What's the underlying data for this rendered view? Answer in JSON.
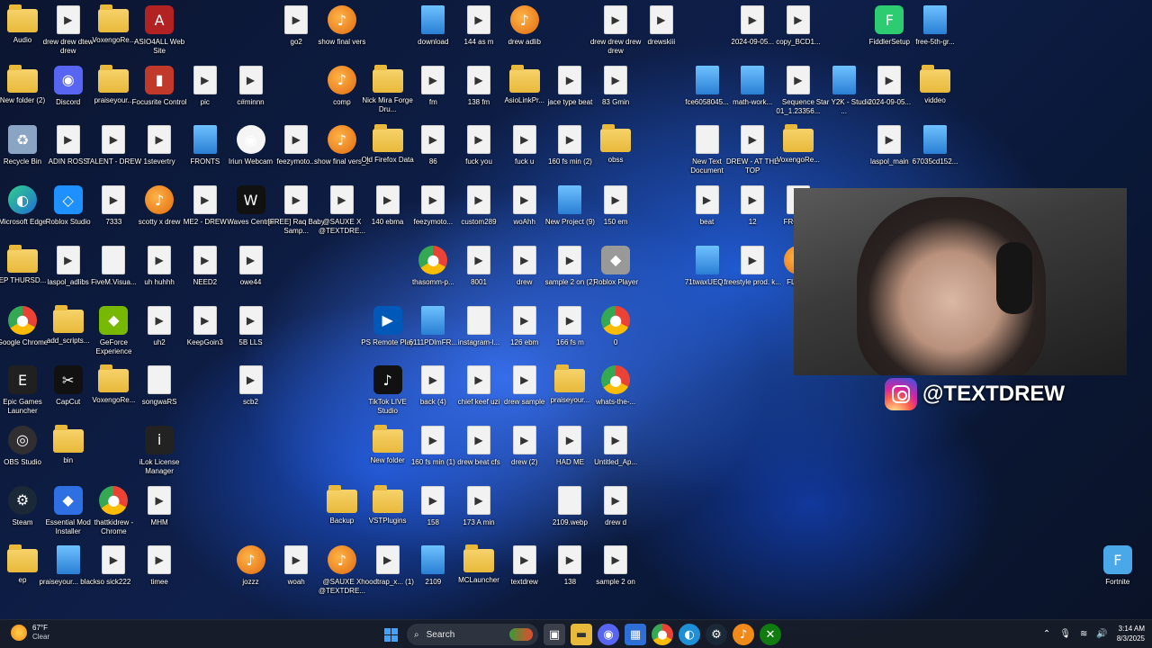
{
  "desktop": {
    "icons": [
      {
        "label": "Audio",
        "icon": "folder-icon"
      },
      {
        "label": "drew drew dtew drew",
        "icon": "file-icon"
      },
      {
        "label": "VoxengoRe...",
        "icon": "folder-icon"
      },
      {
        "label": "ASIO4ALL Web Site",
        "icon": "asio-icon"
      },
      {
        "label": "go2",
        "icon": "file-icon"
      },
      {
        "label": "show final vers",
        "icon": "fl-studio-icon"
      },
      {
        "label": "download",
        "icon": "image-file-icon"
      },
      {
        "label": "144 as m",
        "icon": "file-icon"
      },
      {
        "label": "drew adlib",
        "icon": "fl-studio-icon"
      },
      {
        "label": "drew drew drew drew",
        "icon": "file-icon"
      },
      {
        "label": "drewskiii",
        "icon": "file-icon"
      },
      {
        "label": "2024-09-05...",
        "icon": "file-icon"
      },
      {
        "label": "copy_BCD1...",
        "icon": "file-icon"
      },
      {
        "label": "FiddlerSetup",
        "icon": "setup-icon"
      },
      {
        "label": "free-5th-gr...",
        "icon": "image-file-icon"
      },
      {
        "label": "New folder (2)",
        "icon": "folder-icon"
      },
      {
        "label": "Discord",
        "icon": "discord-icon"
      },
      {
        "label": "praiseyour...",
        "icon": "folder-icon"
      },
      {
        "label": "Focusrite Control",
        "icon": "focusrite-icon"
      },
      {
        "label": "pic",
        "icon": "file-icon"
      },
      {
        "label": "c#minnn",
        "icon": "file-icon"
      },
      {
        "label": "comp",
        "icon": "fl-studio-icon"
      },
      {
        "label": "Nick Mira Forge Dru...",
        "icon": "folder-icon"
      },
      {
        "label": "fm",
        "icon": "file-icon"
      },
      {
        "label": "138 fm",
        "icon": "file-icon"
      },
      {
        "label": "AsioLinkPr...",
        "icon": "folder-icon"
      },
      {
        "label": "jace type beat",
        "icon": "file-icon"
      },
      {
        "label": "83 Gmin",
        "icon": "file-icon"
      },
      {
        "label": "fce6058045...",
        "icon": "image-file-icon"
      },
      {
        "label": "math-work...",
        "icon": "image-file-icon"
      },
      {
        "label": "Sequence 01_1.23356...",
        "icon": "file-icon"
      },
      {
        "label": "Star Y2K - Studio ...",
        "icon": "image-file-icon"
      },
      {
        "label": "2024-09-05...",
        "icon": "file-icon"
      },
      {
        "label": "viddeo",
        "icon": "folder-icon"
      },
      {
        "label": "Recycle Bin",
        "icon": "recycle-bin-icon"
      },
      {
        "label": "ADIN ROSS",
        "icon": "file-icon"
      },
      {
        "label": "TALENT - DREW",
        "icon": "file-icon"
      },
      {
        "label": "1stevertry",
        "icon": "file-icon"
      },
      {
        "label": "FRONTS",
        "icon": "image-file-icon"
      },
      {
        "label": "Iriun Webcam",
        "icon": "webcam-icon"
      },
      {
        "label": "feezymoto...",
        "icon": "file-icon"
      },
      {
        "label": "show final vers_2",
        "icon": "fl-studio-icon"
      },
      {
        "label": "Old Firefox Data",
        "icon": "folder-icon"
      },
      {
        "label": "86",
        "icon": "file-icon"
      },
      {
        "label": "fuck you",
        "icon": "file-icon"
      },
      {
        "label": "fuck u",
        "icon": "file-icon"
      },
      {
        "label": "160 fs min (2)",
        "icon": "file-icon"
      },
      {
        "label": "obss",
        "icon": "folder-icon"
      },
      {
        "label": "New Text Document",
        "icon": "text-file-icon"
      },
      {
        "label": "DREW - AT THE TOP",
        "icon": "file-icon"
      },
      {
        "label": "VoxengoRe...",
        "icon": "folder-icon"
      },
      {
        "label": "laspol_main",
        "icon": "file-icon"
      },
      {
        "label": "67035cd152...",
        "icon": "image-file-icon"
      },
      {
        "label": "Microsoft Edge",
        "icon": "edge-icon"
      },
      {
        "label": "Roblox Studio",
        "icon": "roblox-studio-icon"
      },
      {
        "label": "7333",
        "icon": "file-icon"
      },
      {
        "label": "scotty x drew",
        "icon": "fl-studio-icon"
      },
      {
        "label": "ME2 - DREW",
        "icon": "file-icon"
      },
      {
        "label": "Waves Central",
        "icon": "waves-icon"
      },
      {
        "label": "[FREE] Raq Baby Samp...",
        "icon": "file-icon"
      },
      {
        "label": "@SAUXE X @TEXTDRE...",
        "icon": "file-icon"
      },
      {
        "label": "140 ebma",
        "icon": "file-icon"
      },
      {
        "label": "feezymoto...",
        "icon": "file-icon"
      },
      {
        "label": "custom289",
        "icon": "file-icon"
      },
      {
        "label": "woAhh",
        "icon": "file-icon"
      },
      {
        "label": "New Project (9)",
        "icon": "image-file-icon"
      },
      {
        "label": "150 em",
        "icon": "file-icon"
      },
      {
        "label": "beat",
        "icon": "file-icon"
      },
      {
        "label": "12",
        "icon": "file-icon"
      },
      {
        "label": "FRO... M",
        "icon": "file-icon"
      },
      {
        "label": "EP THURSD...",
        "icon": "folder-icon"
      },
      {
        "label": "laspol_adlibs",
        "icon": "file-icon"
      },
      {
        "label": "FiveM.Visua...",
        "icon": "text-file-icon"
      },
      {
        "label": "uh huhhh",
        "icon": "file-icon"
      },
      {
        "label": "NEED2",
        "icon": "file-icon"
      },
      {
        "label": "owe44",
        "icon": "file-icon"
      },
      {
        "label": "thasomm-p...",
        "icon": "chrome-icon"
      },
      {
        "label": "8001",
        "icon": "file-icon"
      },
      {
        "label": "drew",
        "icon": "file-icon"
      },
      {
        "label": "sample 2 on (2)",
        "icon": "file-icon"
      },
      {
        "label": "Roblox Player",
        "icon": "roblox-icon"
      },
      {
        "label": "71twaxUEQ...",
        "icon": "image-file-icon"
      },
      {
        "label": "freestyle prod. k...",
        "icon": "file-icon"
      },
      {
        "label": "FL St...",
        "icon": "fl-studio-icon"
      },
      {
        "label": "Google Chrome",
        "icon": "chrome-icon"
      },
      {
        "label": "add_scripts...",
        "icon": "folder-icon"
      },
      {
        "label": "GeForce Experience",
        "icon": "geforce-icon"
      },
      {
        "label": "uh2",
        "icon": "file-icon"
      },
      {
        "label": "KeepGoin3",
        "icon": "file-icon"
      },
      {
        "label": "5B LLS",
        "icon": "file-icon"
      },
      {
        "label": "PS Remote Play",
        "icon": "ps-remote-icon"
      },
      {
        "label": "6111PDlmFR...",
        "icon": "image-file-icon"
      },
      {
        "label": "instagram-l...",
        "icon": "text-file-icon"
      },
      {
        "label": "126 ebm",
        "icon": "file-icon"
      },
      {
        "label": "166 fs m",
        "icon": "file-icon"
      },
      {
        "label": "0",
        "icon": "chrome-icon"
      },
      {
        "label": "Epic Games Launcher",
        "icon": "epic-games-icon"
      },
      {
        "label": "CapCut",
        "icon": "capcut-icon"
      },
      {
        "label": "VoxengoRe...",
        "icon": "folder-icon"
      },
      {
        "label": "songwaRS",
        "icon": "text-file-icon"
      },
      {
        "label": "scb2",
        "icon": "file-icon"
      },
      {
        "label": "TikTok LIVE Studio",
        "icon": "tiktok-icon"
      },
      {
        "label": "back (4)",
        "icon": "file-icon"
      },
      {
        "label": "chief keef uzi",
        "icon": "file-icon"
      },
      {
        "label": "drew sample",
        "icon": "file-icon"
      },
      {
        "label": "praiseyour...",
        "icon": "folder-icon"
      },
      {
        "label": "whats-the-...",
        "icon": "chrome-icon"
      },
      {
        "label": "OBS Studio",
        "icon": "obs-icon"
      },
      {
        "label": "bin",
        "icon": "folder-icon"
      },
      {
        "label": "iLok License Manager",
        "icon": "ilok-icon"
      },
      {
        "label": "New folder",
        "icon": "folder-icon"
      },
      {
        "label": "160 fs min (1)",
        "icon": "file-icon"
      },
      {
        "label": "drew beat cfs",
        "icon": "file-icon"
      },
      {
        "label": "drew (2)",
        "icon": "file-icon"
      },
      {
        "label": "HAD ME",
        "icon": "file-icon"
      },
      {
        "label": "Untitled_Ap...",
        "icon": "file-icon"
      },
      {
        "label": "Steam",
        "icon": "steam-icon"
      },
      {
        "label": "Essential Mod Installer",
        "icon": "essential-icon"
      },
      {
        "label": "thattkidrew - Chrome",
        "icon": "chrome-icon"
      },
      {
        "label": "MHM",
        "icon": "file-icon"
      },
      {
        "label": "Backup",
        "icon": "folder-icon"
      },
      {
        "label": "VSTPlugins",
        "icon": "folder-icon"
      },
      {
        "label": "158",
        "icon": "file-icon"
      },
      {
        "label": "173 A min",
        "icon": "file-icon"
      },
      {
        "label": "2109.webp",
        "icon": "text-file-icon"
      },
      {
        "label": "drew d",
        "icon": "file-icon"
      },
      {
        "label": "ep",
        "icon": "folder-icon"
      },
      {
        "label": "praiseyour... black",
        "icon": "image-file-icon"
      },
      {
        "label": "so sick222",
        "icon": "file-icon"
      },
      {
        "label": "timee",
        "icon": "file-icon"
      },
      {
        "label": "jozzz",
        "icon": "fl-studio-icon"
      },
      {
        "label": "woah",
        "icon": "file-icon"
      },
      {
        "label": "@SAUXE X @TEXTDRE...",
        "icon": "fl-studio-icon"
      },
      {
        "label": "hoodtrap_x... (1)",
        "icon": "file-icon"
      },
      {
        "label": "2109",
        "icon": "image-file-icon"
      },
      {
        "label": "MCLauncher",
        "icon": "folder-icon"
      },
      {
        "label": "textdrew",
        "icon": "file-icon"
      },
      {
        "label": "138",
        "icon": "file-icon"
      },
      {
        "label": "sample 2 on",
        "icon": "file-icon"
      },
      {
        "label": "Fortnite",
        "icon": "fortnite-icon"
      }
    ]
  },
  "overlay": {
    "handle": "@TEXTDREW",
    "instagram_icon": "instagram-icon"
  },
  "taskbar": {
    "weather_temp": "67°F",
    "weather_desc": "Clear",
    "search_placeholder": "Search",
    "time": "3:14 AM",
    "date": "8/3/2025"
  },
  "colors": {
    "folder": "#e8b93a",
    "accent": "#3fa3ff",
    "taskbar_bg": "#181c28"
  }
}
